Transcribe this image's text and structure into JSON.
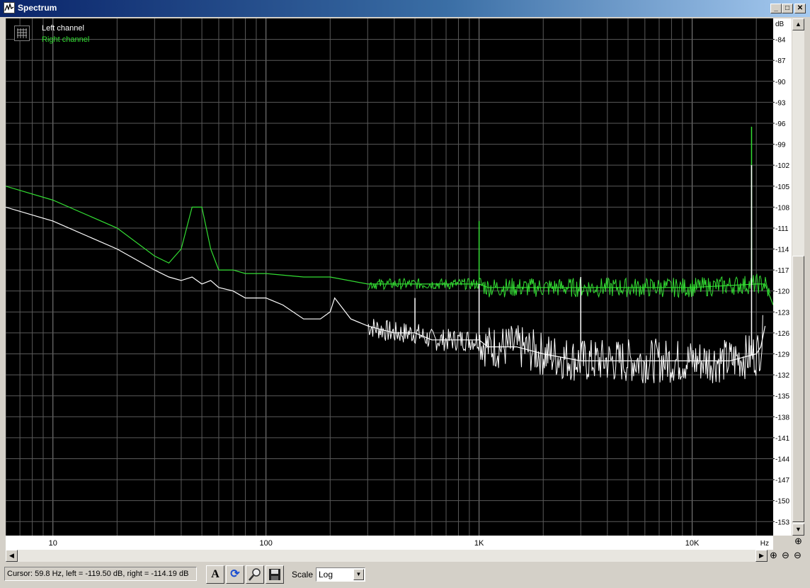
{
  "window": {
    "title": "Spectrum"
  },
  "legend": {
    "left": {
      "label": "Left channel",
      "color": "#ffffff"
    },
    "right": {
      "label": "Right channel",
      "color": "#33dd33"
    }
  },
  "yaxis": {
    "unit": "dB",
    "ticks": [
      "-84",
      "-87",
      "-90",
      "-93",
      "-96",
      "-99",
      "-102",
      "-105",
      "-108",
      "-111",
      "-114",
      "-117",
      "-120",
      "-123",
      "-126",
      "-129",
      "-132",
      "-135",
      "-138",
      "-141",
      "-144",
      "-147",
      "-150",
      "-153"
    ]
  },
  "xaxis": {
    "unit": "Hz",
    "ticks": [
      "10",
      "100",
      "1K",
      "10K"
    ]
  },
  "status": {
    "cursor_text": "Cursor:  59.8 Hz,  left = -119.50 dB,  right = -114.19 dB",
    "scale_label": "Scale",
    "scale_value": "Log"
  },
  "chart_data": {
    "type": "line",
    "xscale": "log",
    "xlim": [
      6,
      24000
    ],
    "ylim": [
      -155,
      -81
    ],
    "grid": true,
    "legend_position": "top-left",
    "series": [
      {
        "name": "Left channel",
        "color": "#ffffff",
        "x": [
          6,
          10,
          20,
          30,
          35,
          40,
          45,
          50,
          55,
          60,
          70,
          80,
          100,
          120,
          150,
          180,
          200,
          210,
          250,
          300,
          400,
          500,
          600,
          800,
          1000,
          1100,
          1500,
          2000,
          3000,
          5000,
          10000,
          15000,
          20000,
          21000,
          22000
        ],
        "y": [
          -108,
          -110,
          -114,
          -117,
          -118,
          -118.5,
          -118,
          -119,
          -118.5,
          -119.5,
          -120,
          -121,
          -121,
          -122,
          -124,
          -124,
          -123,
          -121,
          -124,
          -125,
          -126,
          -126,
          -127,
          -127,
          -127,
          -128,
          -128,
          -129,
          -130,
          -130,
          -130,
          -130,
          -129,
          -128,
          -125
        ]
      },
      {
        "name": "Right channel",
        "color": "#33dd33",
        "x": [
          6,
          10,
          20,
          30,
          35,
          40,
          45,
          50,
          55,
          60,
          70,
          80,
          100,
          150,
          200,
          300,
          500,
          1000,
          1100,
          2000,
          5000,
          10000,
          20000,
          22000,
          24000
        ],
        "y": [
          -105,
          -107,
          -111,
          -115,
          -116,
          -114,
          -108,
          -108,
          -114,
          -117,
          -117,
          -117.5,
          -117.5,
          -118,
          -118,
          -119,
          -119,
          -119,
          -119.5,
          -119.5,
          -119.5,
          -119.5,
          -119,
          -119,
          -122
        ]
      }
    ],
    "peaks": [
      {
        "channel": "Right channel",
        "x": 1000,
        "y": -110
      },
      {
        "channel": "Right channel",
        "x": 19000,
        "y": -96.5
      },
      {
        "channel": "Left channel",
        "x": 1000,
        "y": -119
      },
      {
        "channel": "Left channel",
        "x": 500,
        "y": -121
      },
      {
        "channel": "Left channel",
        "x": 3000,
        "y": -118
      },
      {
        "channel": "Left channel",
        "x": 19000,
        "y": -102
      }
    ]
  }
}
